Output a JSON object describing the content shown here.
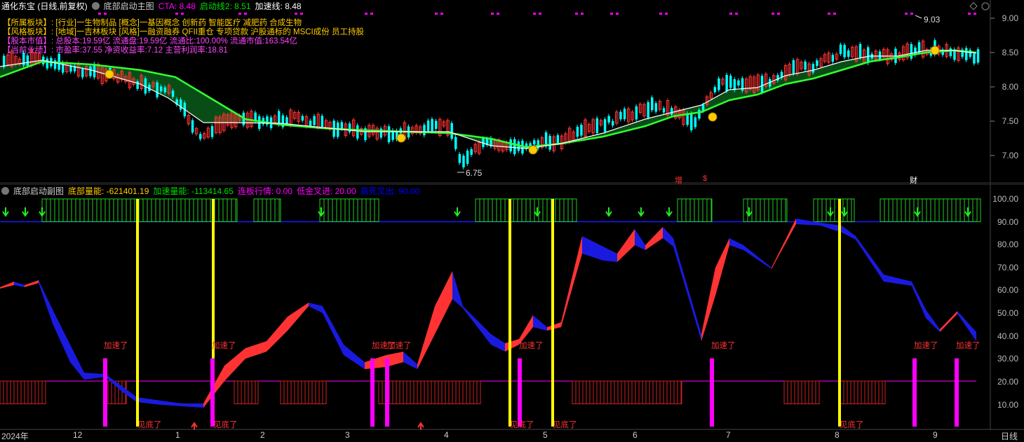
{
  "colors": {
    "magenta": "#ff00ff",
    "green": "#00dd00",
    "red": "#ff3333",
    "blue": "#0000ff",
    "yellow": "#ffff00",
    "orange": "#ffcc00",
    "cyan": "#00ffff"
  },
  "main": {
    "title": "通化东宝 (日线,前复权)",
    "indicator_name": "底部启动主图",
    "cta": "CTA: 8.48",
    "qidong2": "启动线2: 8.51",
    "jiasu": "加速线: 8.48",
    "info_line1": "【所属板块】: [行业]一生物制品 [概念]一基因概念 创新药 智能医疗 减肥药 合成生物",
    "info_line2": "【风格板块】: [地域]一吉林板块 [风格]一融资融券 QFII重仓 专项贷款 沪股通标的 MSCI成份 员工持股",
    "info_line3": "【股本市值】: 总股本:19.59亿 流通盘:19.59亿 流通比:100.00% 流通市值:163.54亿",
    "info_line4": "【当前业绩】: 市盈率:37.55 净资收益率:7.12 主营利润率:18.81",
    "price_high": "9.03",
    "price_low": "6.75",
    "y_labels": [
      "9.00",
      "8.50",
      "8.00",
      "7.50",
      "7.00"
    ],
    "markers": [
      {
        "text": "增",
        "color": "#ff3333"
      },
      {
        "text": "$",
        "color": "#ff3333"
      },
      {
        "text": "财",
        "color": "#ffffff"
      }
    ]
  },
  "sub": {
    "indicator_name": "底部启动副图",
    "dibu": "底部量能: -621401.19",
    "jiasu": "加速量能: -113414.65",
    "lianban": "连板行情: 0.00",
    "dijin": "低金叉进: 20.00",
    "gaosi": "高死叉出: 90.00",
    "y_labels": [
      "100.00",
      "90.00",
      "80.00",
      "70.00",
      "60.00",
      "50.00",
      "40.00",
      "30.00",
      "20.00",
      "10.00"
    ],
    "tag_jiasu": "加速了",
    "tag_jiandi": "见底了"
  },
  "bottom": {
    "year": "2024年",
    "months": [
      "12",
      "1",
      "2",
      "3",
      "4",
      "5",
      "6",
      "7",
      "8",
      "9"
    ],
    "period": "日线"
  }
}
